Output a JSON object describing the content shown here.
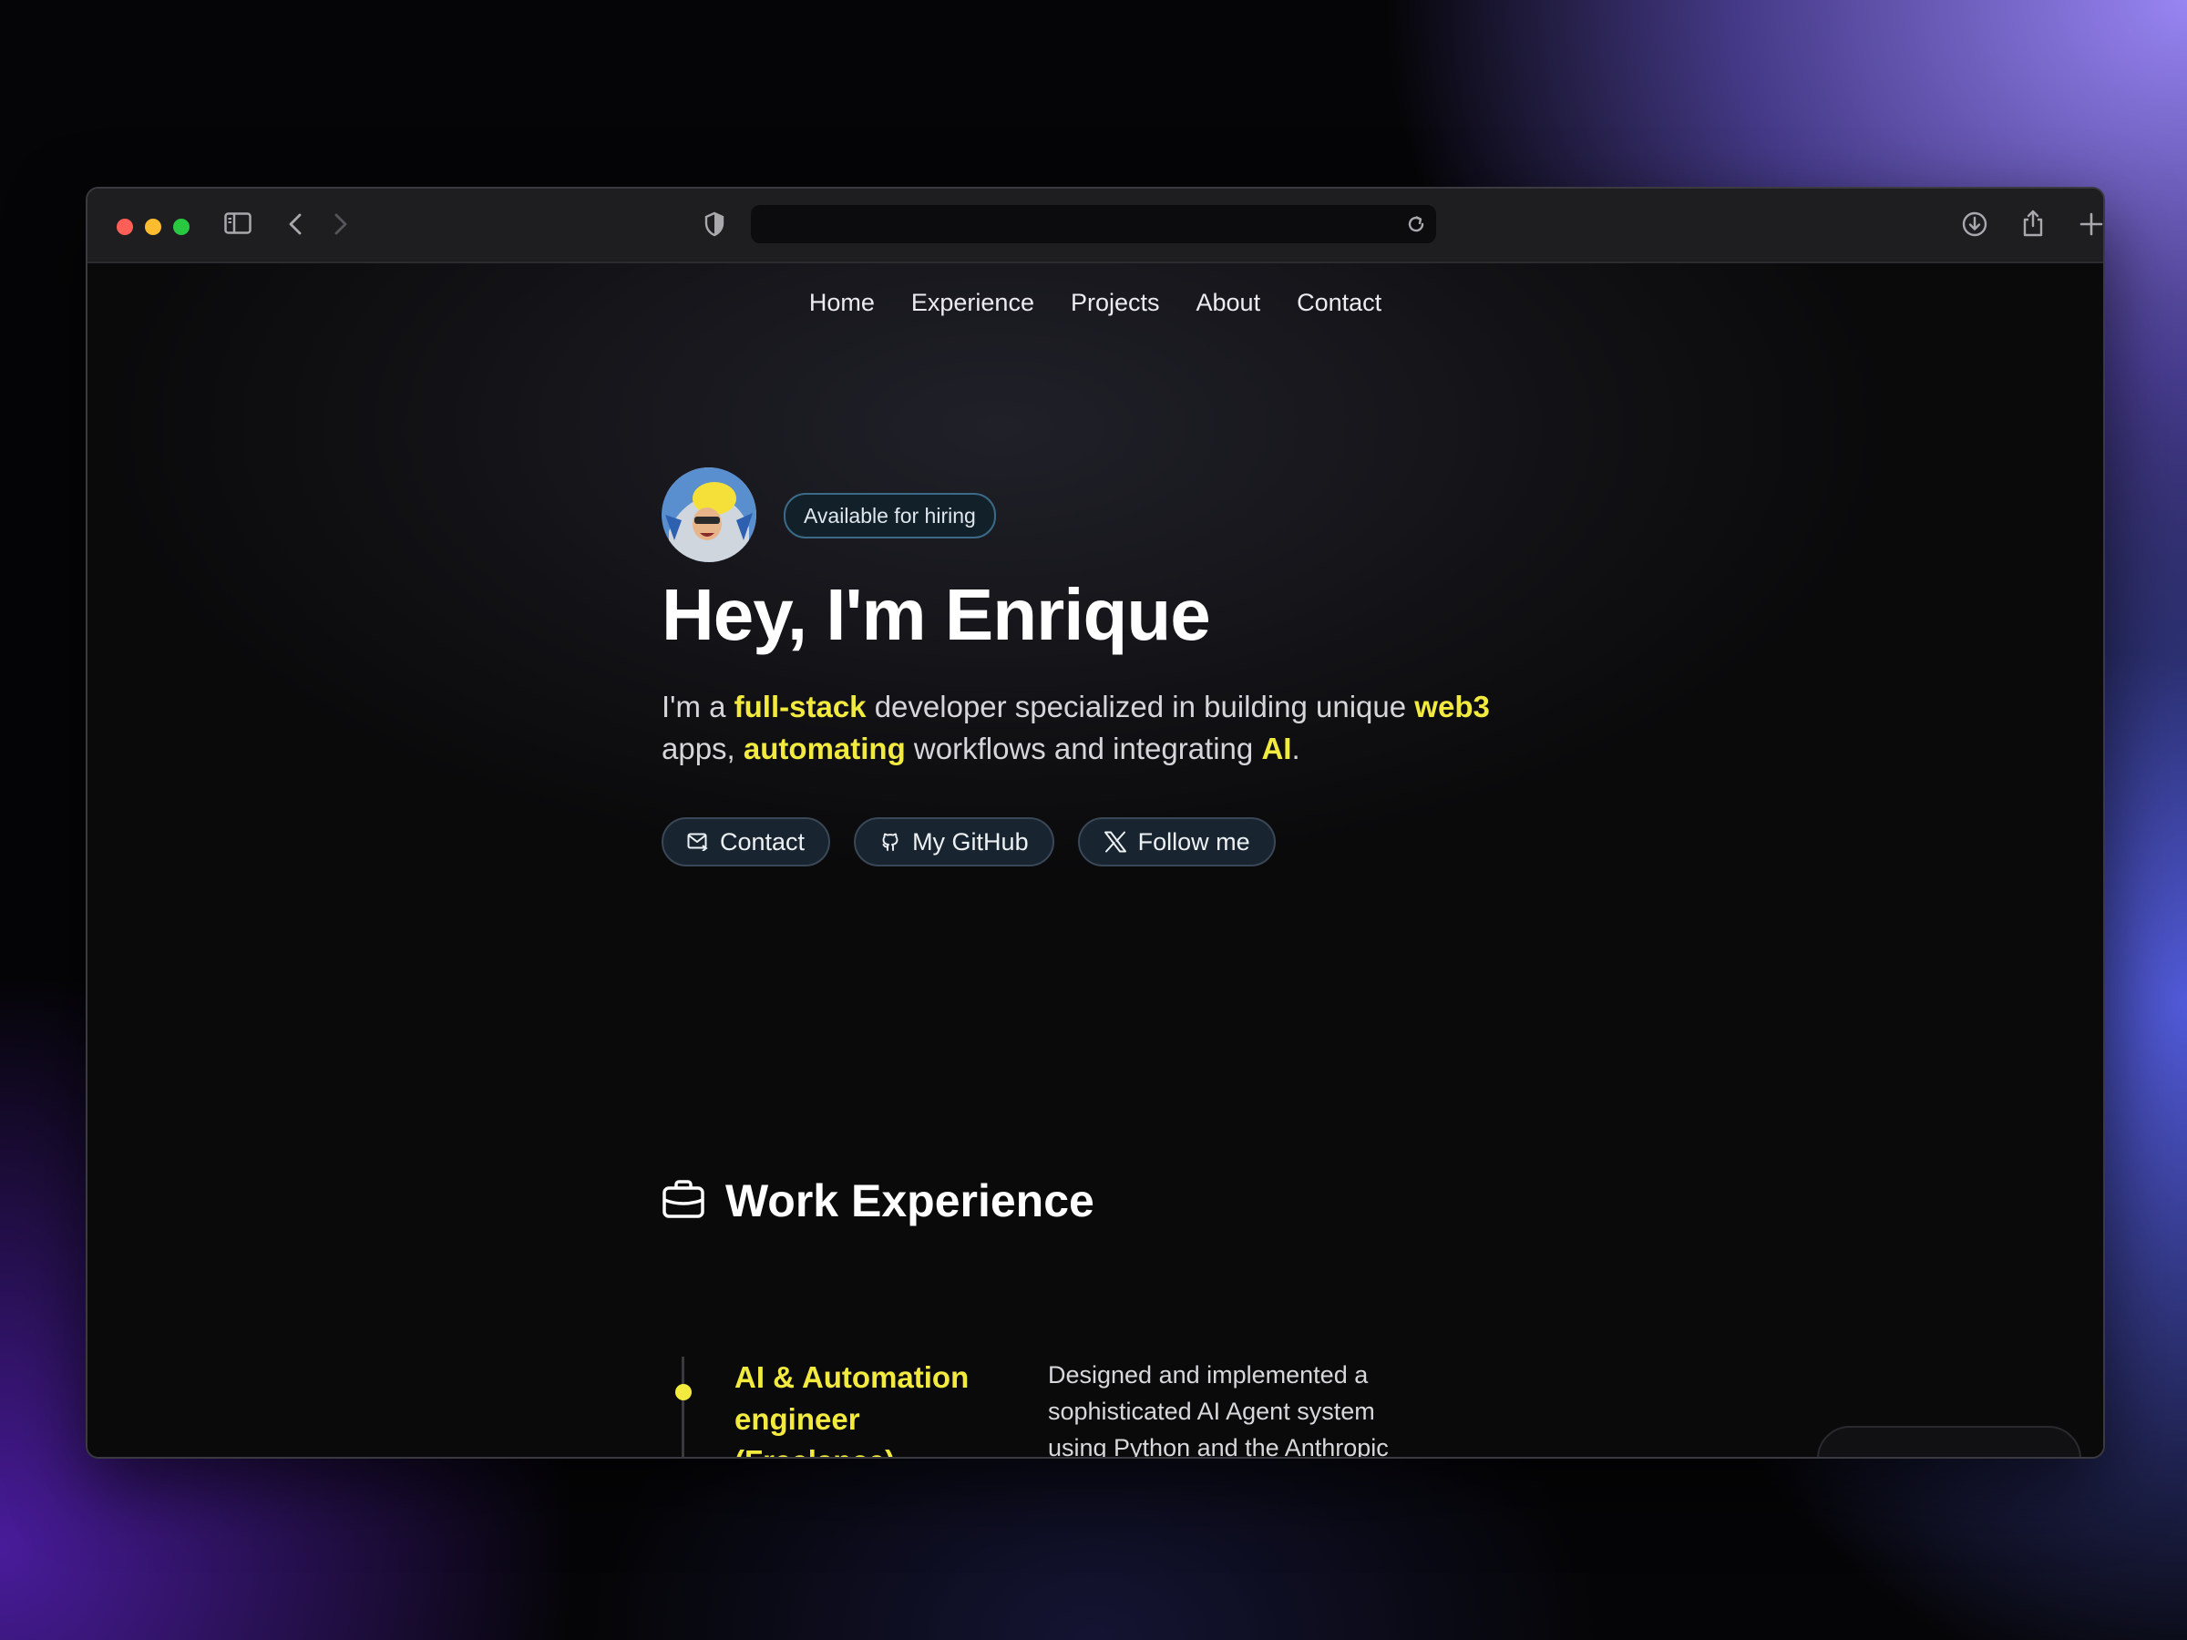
{
  "browser": {
    "url": ""
  },
  "nav": {
    "items": [
      {
        "label": "Home"
      },
      {
        "label": "Experience"
      },
      {
        "label": "Projects"
      },
      {
        "label": "About"
      },
      {
        "label": "Contact"
      }
    ]
  },
  "hero": {
    "badge": "Available for hiring",
    "title": "Hey, I'm Enrique",
    "intro": {
      "p1": "I'm a ",
      "hl1": "full-stack",
      "p2": " developer specialized in building unique ",
      "hl2": "web3",
      "p3": " apps, ",
      "hl3": "automating",
      "p4": " workflows and integrating ",
      "hl4": "AI",
      "p5": "."
    },
    "actions": {
      "contact": "Contact",
      "github": "My GitHub",
      "follow": "Follow me"
    }
  },
  "experience": {
    "title": "Work Experience",
    "items": [
      {
        "role": "AI & Automation engineer (Freelance)",
        "description": "Designed and implemented a sophisticated AI Agent system using Python and the Anthropic"
      }
    ]
  },
  "colors": {
    "accent": "#f2ea3f",
    "background": "#0a0a0b",
    "pill_bg": "#182530"
  }
}
